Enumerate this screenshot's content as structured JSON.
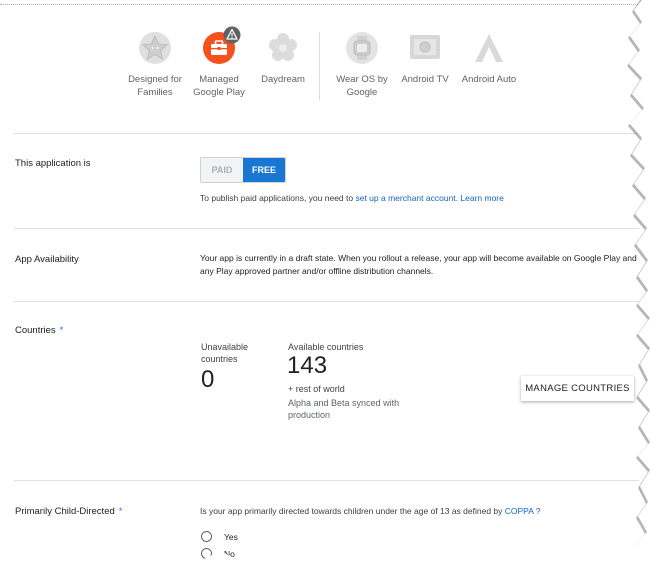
{
  "distribution": {
    "items": [
      {
        "label": "Designed for\nFamilies",
        "icon": "star-badge-icon",
        "state": "disabled"
      },
      {
        "label": "Managed\nGoogle Play",
        "icon": "briefcase-icon",
        "badge": "warning-icon",
        "state": "active",
        "color": "#f4511e"
      },
      {
        "label": "Daydream",
        "icon": "daydream-icon",
        "state": "disabled"
      },
      {
        "label": "Wear OS by\nGoogle",
        "icon": "watch-icon",
        "state": "disabled"
      },
      {
        "label": "Android TV",
        "icon": "tv-icon",
        "state": "disabled"
      },
      {
        "label": "Android Auto",
        "icon": "auto-icon",
        "state": "disabled"
      }
    ]
  },
  "pricing": {
    "label": "This application is",
    "paid": "PAID",
    "free": "FREE",
    "selected": "FREE",
    "note_prefix": "To publish paid applications, you need to ",
    "note_link": "set up a merchant account.",
    "learn_more": "Learn more"
  },
  "availability": {
    "label": "App Availability",
    "text": "Your app is currently in a draft state. When you rollout a release, your app will become available on Google Play and any Play approved partner and/or offline distribution channels."
  },
  "countries": {
    "label": "Countries",
    "required": "*",
    "unavailable_label": "Unavailable countries",
    "unavailable_count": "0",
    "available_label": "Available countries",
    "available_count": "143",
    "rest_of_world": "+ rest of world",
    "sync_note": "Alpha and Beta synced with production",
    "manage_button": "MANAGE COUNTRIES"
  },
  "child_directed": {
    "label": "Primarily Child-Directed",
    "required": "*",
    "question_prefix": "Is your app primarily directed towards children under the age of 13 as defined by ",
    "question_link": "COPPA",
    "question_suffix": " ?",
    "options": [
      "Yes",
      "No"
    ]
  },
  "colors": {
    "accent": "#1976d2",
    "link": "#1565c0",
    "managed_play": "#f4511e",
    "disabled_icon": "#d6d6d6"
  }
}
